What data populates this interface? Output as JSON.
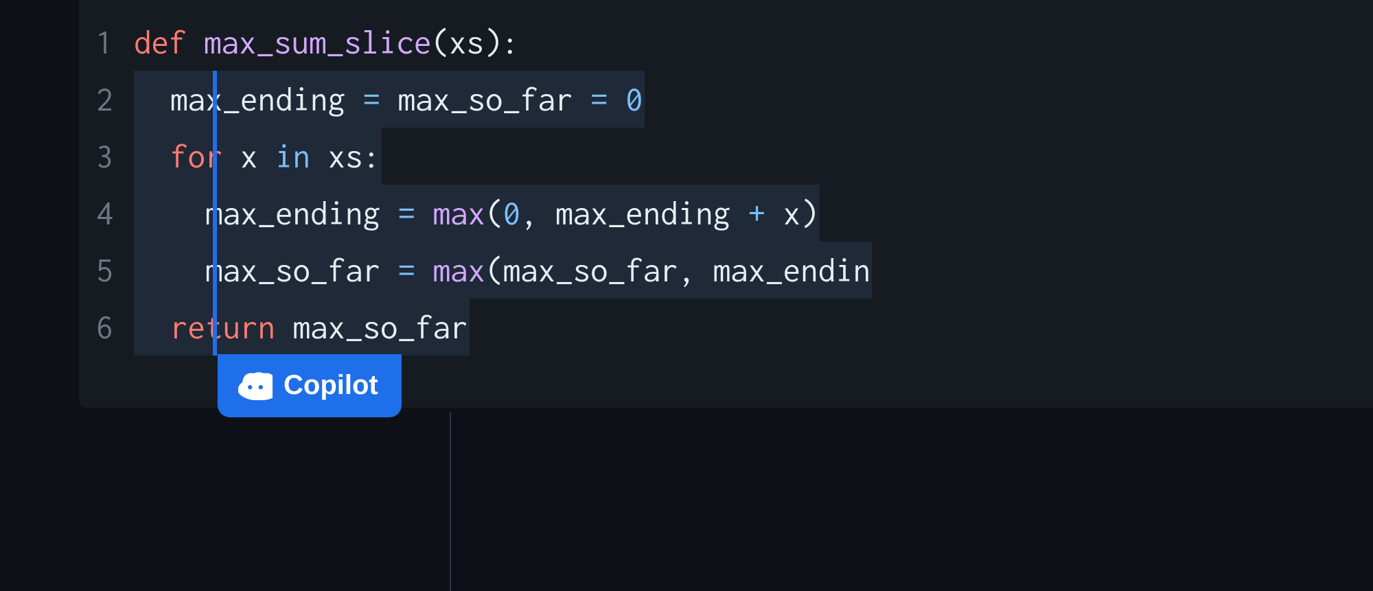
{
  "copilot": {
    "label": "Copilot"
  },
  "lineNumbers": [
    "1",
    "2",
    "3",
    "4",
    "5",
    "6"
  ],
  "code": {
    "line1": {
      "tokens": [
        {
          "text": "def ",
          "cls": "tok-keyword"
        },
        {
          "text": "max_sum_slice",
          "cls": "tok-funcname"
        },
        {
          "text": "(",
          "cls": "tok-paren"
        },
        {
          "text": "xs",
          "cls": "tok-param"
        },
        {
          "text": ")",
          "cls": "tok-paren"
        },
        {
          "text": ":",
          "cls": "tok-colon"
        }
      ]
    },
    "line2": {
      "tokens": [
        {
          "text": "  max_ending ",
          "cls": "tok-identifier"
        },
        {
          "text": "=",
          "cls": "tok-operator"
        },
        {
          "text": " max_so_far ",
          "cls": "tok-identifier"
        },
        {
          "text": "=",
          "cls": "tok-operator"
        },
        {
          "text": " ",
          "cls": "tok-default"
        },
        {
          "text": "0",
          "cls": "tok-number"
        }
      ]
    },
    "line3": {
      "tokens": [
        {
          "text": "  ",
          "cls": "tok-default"
        },
        {
          "text": "for",
          "cls": "tok-keyword"
        },
        {
          "text": " x ",
          "cls": "tok-identifier"
        },
        {
          "text": "in",
          "cls": "tok-in"
        },
        {
          "text": " xs",
          "cls": "tok-identifier"
        },
        {
          "text": ":",
          "cls": "tok-colon"
        }
      ]
    },
    "line4": {
      "tokens": [
        {
          "text": "    max_ending ",
          "cls": "tok-identifier"
        },
        {
          "text": "=",
          "cls": "tok-operator"
        },
        {
          "text": " ",
          "cls": "tok-default"
        },
        {
          "text": "max",
          "cls": "tok-builtin"
        },
        {
          "text": "(",
          "cls": "tok-paren"
        },
        {
          "text": "0",
          "cls": "tok-number"
        },
        {
          "text": ", max_ending ",
          "cls": "tok-identifier"
        },
        {
          "text": "+",
          "cls": "tok-operator"
        },
        {
          "text": " x",
          "cls": "tok-identifier"
        },
        {
          "text": ")",
          "cls": "tok-paren"
        }
      ]
    },
    "line5": {
      "tokens": [
        {
          "text": "    max_so_far ",
          "cls": "tok-identifier"
        },
        {
          "text": "=",
          "cls": "tok-operator"
        },
        {
          "text": " ",
          "cls": "tok-default"
        },
        {
          "text": "max",
          "cls": "tok-builtin"
        },
        {
          "text": "(",
          "cls": "tok-paren"
        },
        {
          "text": "max_so_far, max_endin",
          "cls": "tok-identifier"
        }
      ]
    },
    "line6": {
      "tokens": [
        {
          "text": "  ",
          "cls": "tok-default"
        },
        {
          "text": "return",
          "cls": "tok-keyword"
        },
        {
          "text": " max_so_far",
          "cls": "tok-identifier"
        }
      ]
    }
  }
}
